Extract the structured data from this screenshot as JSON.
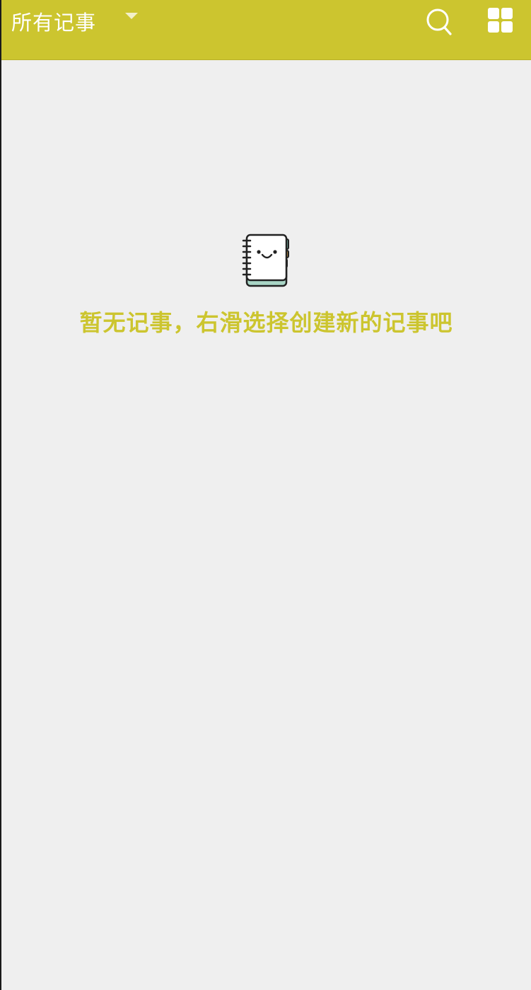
{
  "topbar": {
    "title": "所有记事",
    "dropdown_icon": "caret-down-icon",
    "search_icon": "search-icon",
    "grid_icon": "grid-view-icon",
    "background_color": "#ccc52f"
  },
  "empty_state": {
    "icon": "notebook-smiley-icon",
    "message": "暂无记事，右滑选择创建新的记事吧",
    "text_color": "#ccc52f"
  },
  "colors": {
    "accent": "#ccc52f",
    "background": "#efefef"
  }
}
